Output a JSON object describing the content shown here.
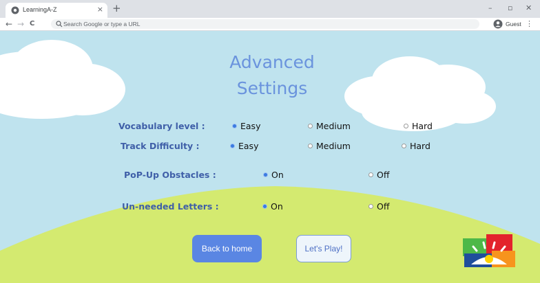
{
  "browser": {
    "tab_title": "LearningA-Z",
    "tab_close": "×",
    "new_tab": "+",
    "window_controls": {
      "minimize": "–",
      "restore": "▫",
      "close": "✕"
    },
    "nav": {
      "back": "←",
      "forward": "→",
      "reload": "C"
    },
    "omnibox_placeholder": "Search Google or type a URL",
    "profile_label": "Guest",
    "menu": "⋮",
    "icons": [
      "favicon-icon",
      "search-icon",
      "profile-icon"
    ]
  },
  "page": {
    "title_line1": "Advanced",
    "title_line2": "Settings",
    "settings": {
      "vocabulary": {
        "label": "Vocabulary level :",
        "options": [
          {
            "label": "Easy",
            "selected": true
          },
          {
            "label": "Medium",
            "selected": false
          },
          {
            "label": "Hard",
            "selected": false
          }
        ]
      },
      "track": {
        "label": "Track Difficulty :",
        "options": [
          {
            "label": "Easy",
            "selected": true
          },
          {
            "label": "Medium",
            "selected": false
          },
          {
            "label": "Hard",
            "selected": false
          }
        ]
      },
      "popup": {
        "label": "PoP-Up Obstacles :",
        "options": [
          {
            "label": "On",
            "selected": true
          },
          {
            "label": "Off",
            "selected": false
          }
        ]
      },
      "unneeded": {
        "label": "Un-needed Letters :",
        "options": [
          {
            "label": "On",
            "selected": true
          },
          {
            "label": "Off",
            "selected": false
          }
        ]
      }
    },
    "buttons": {
      "back_home": "Back to home",
      "lets_play": "Let's Play!"
    },
    "colors": {
      "sky": "#bfe3ee",
      "hill": "#d4ea70",
      "title": "#6a93dd",
      "label": "#3f5fa8",
      "primary_button": "#5a86e3"
    }
  }
}
